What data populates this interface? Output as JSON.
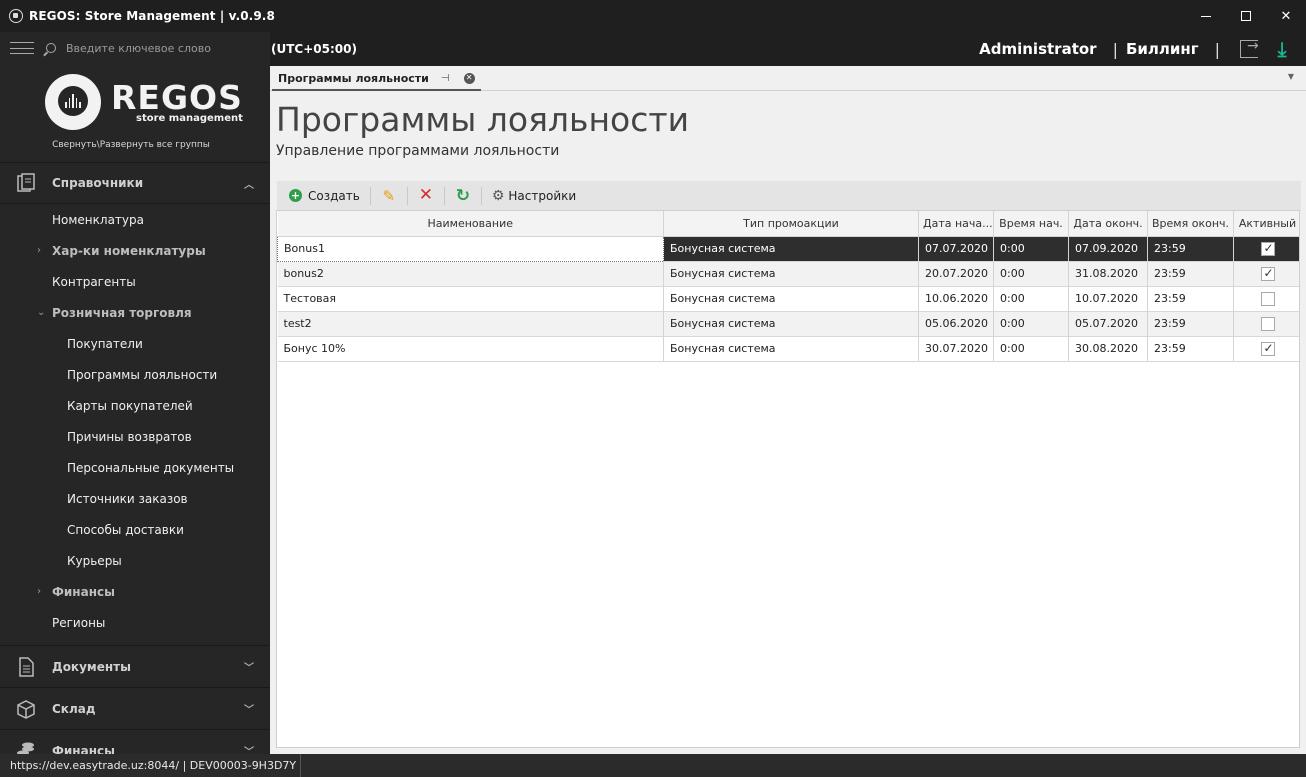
{
  "window": {
    "title": "REGOS: Store Management | v.0.9.8"
  },
  "search": {
    "placeholder": "Введите ключевое слово"
  },
  "logo": {
    "name": "REGOS",
    "tagline": "store management"
  },
  "sidebar": {
    "collapse_link": "Свернуть\\Развернуть все группы",
    "sections": [
      {
        "label": "Справочники",
        "icon": "book-icon"
      },
      {
        "label": "Документы",
        "icon": "document-icon"
      },
      {
        "label": "Склад",
        "icon": "box-icon"
      },
      {
        "label": "Финансы",
        "icon": "coins-icon"
      }
    ],
    "items": [
      {
        "label": "Номенклатура"
      },
      {
        "label": "Хар-ки номенклатуры"
      },
      {
        "label": "Контрагенты"
      },
      {
        "label": "Розничная торговля"
      },
      {
        "label": "Покупатели"
      },
      {
        "label": "Программы лояльности"
      },
      {
        "label": "Карты покупателей"
      },
      {
        "label": "Причины возвратов"
      },
      {
        "label": "Персональные документы"
      },
      {
        "label": "Источники заказов"
      },
      {
        "label": "Способы доставки"
      },
      {
        "label": "Курьеры"
      },
      {
        "label": "Финансы"
      },
      {
        "label": "Регионы"
      }
    ]
  },
  "topbar": {
    "timezone": "(UTC+05:00)",
    "user": "Administrator",
    "separator": "|",
    "billing": "Биллинг"
  },
  "tab": {
    "label": "Программы лояльности"
  },
  "page": {
    "title": "Программы лояльности",
    "subtitle": "Управление программами лояльности"
  },
  "toolbar": {
    "create": "Создать",
    "settings": "Настройки"
  },
  "table": {
    "columns": [
      "Наименование",
      "Тип промоакции",
      "Дата нача...",
      "Время нач.",
      "Дата оконч.",
      "Время оконч.",
      "Активный"
    ],
    "rows": [
      {
        "name": "Bonus1",
        "type": "Бонусная система",
        "start_date": "07.07.2020",
        "start_time": "0:00",
        "end_date": "07.09.2020",
        "end_time": "23:59",
        "active": true
      },
      {
        "name": "bonus2",
        "type": "Бонусная система",
        "start_date": "20.07.2020",
        "start_time": "0:00",
        "end_date": "31.08.2020",
        "end_time": "23:59",
        "active": true
      },
      {
        "name": "Тестовая",
        "type": "Бонусная система",
        "start_date": "10.06.2020",
        "start_time": "0:00",
        "end_date": "10.07.2020",
        "end_time": "23:59",
        "active": false
      },
      {
        "name": "test2",
        "type": "Бонусная система",
        "start_date": "05.06.2020",
        "start_time": "0:00",
        "end_date": "05.07.2020",
        "end_time": "23:59",
        "active": false
      },
      {
        "name": "Бонус 10%",
        "type": "Бонусная система",
        "start_date": "30.07.2020",
        "start_time": "0:00",
        "end_date": "30.08.2020",
        "end_time": "23:59",
        "active": true
      }
    ]
  },
  "status": {
    "url": "https://dev.easytrade.uz:8044/",
    "separator": "|",
    "device": "DEV00003-9H3D7Y"
  },
  "colors": {
    "accent": "#1ab394",
    "create_green": "#2e9e4a",
    "delete_red": "#d32f2f",
    "edit_orange": "#e0a010",
    "selected_row": "#2e2e2e"
  }
}
